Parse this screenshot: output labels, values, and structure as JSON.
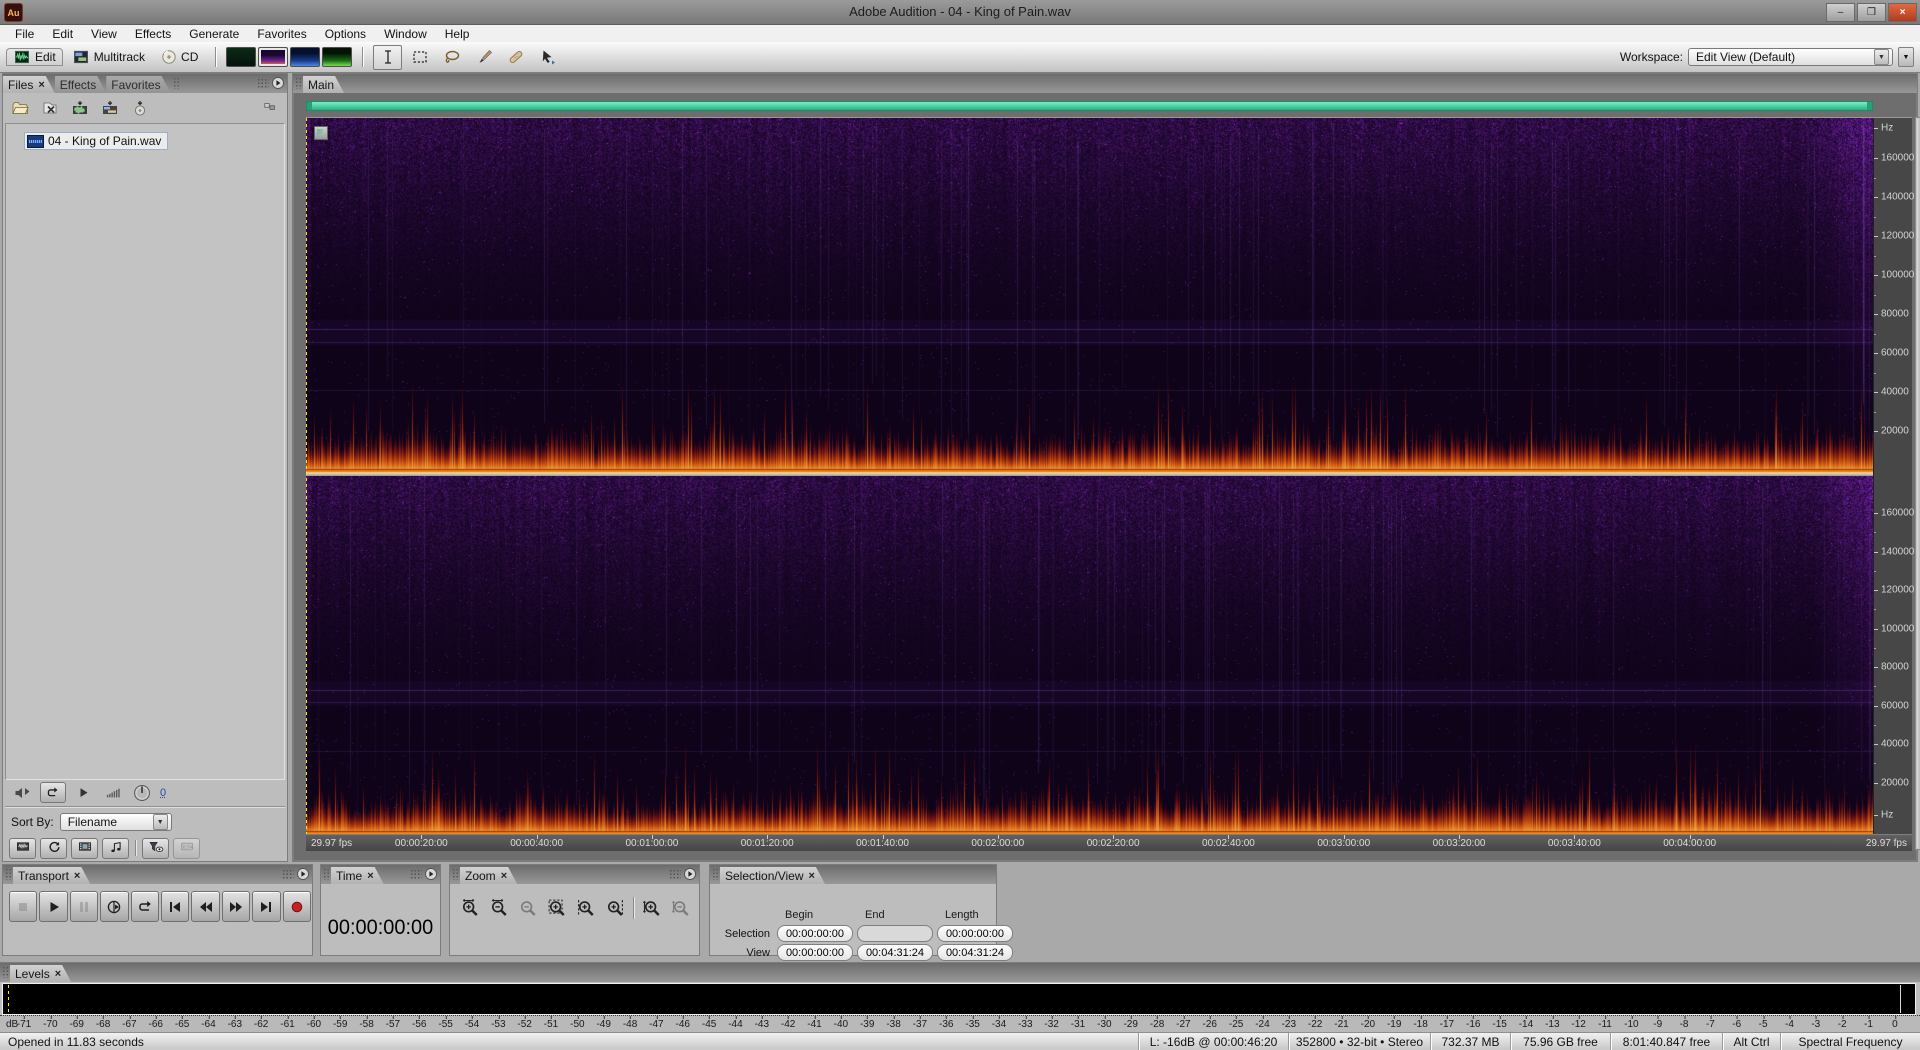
{
  "window": {
    "app_icon_label": "Au",
    "title": "Adobe Audition - 04 - King of Pain.wav"
  },
  "ui_glyphs": {
    "close": "×",
    "dropdown": "▼",
    "minimize": "–",
    "maximize": "❒"
  },
  "menu_bar": [
    "File",
    "Edit",
    "View",
    "Effects",
    "Generate",
    "Favorites",
    "Options",
    "Window",
    "Help"
  ],
  "toolbar": {
    "mode_buttons": [
      {
        "label": "Edit",
        "icon": "edit-view",
        "active": true
      },
      {
        "label": "Multitrack",
        "icon": "multitrack-view",
        "active": false
      },
      {
        "label": "CD",
        "icon": "cd-view",
        "active": false
      }
    ],
    "display_buttons": [
      {
        "name": "waveform-display",
        "active": false
      },
      {
        "name": "spectral-frequency-display",
        "active": true
      },
      {
        "name": "spectral-pan-display",
        "active": false
      },
      {
        "name": "spectral-phase-display",
        "active": false
      }
    ],
    "tool_buttons": [
      {
        "name": "time-selection-tool",
        "active": true
      },
      {
        "name": "marquee-selection-tool",
        "active": false
      },
      {
        "name": "lasso-selection-tool",
        "active": false
      },
      {
        "name": "effects-paintbrush-tool",
        "active": false
      },
      {
        "name": "spot-healing-brush-tool",
        "active": false
      },
      {
        "name": "scrub-tool",
        "active": false
      }
    ],
    "workspace_label": "Workspace:",
    "workspace_value": "Edit View (Default)"
  },
  "files_panel": {
    "tabs": [
      {
        "label": "Files",
        "active": true,
        "closable": true
      },
      {
        "label": "Effects",
        "active": false,
        "closable": false
      },
      {
        "label": "Favorites",
        "active": false,
        "closable": false
      }
    ],
    "toolbar_icons": [
      "import-file",
      "close-files",
      "edit-file",
      "insert-into-multitrack",
      "insert-into-cd"
    ],
    "advanced_options_icon": "advanced-options",
    "files": [
      {
        "name": "04 - King of Pain.wav",
        "selected": true
      }
    ],
    "preview_controls": [
      "auto-play",
      "loop-playback",
      "play-preview",
      "preview-volume",
      "preview-knob"
    ],
    "preview_value": "0",
    "sort_by_label": "Sort By:",
    "sort_by_value": "Filename",
    "filter_buttons": [
      "show-audio-files",
      "show-loop-files",
      "show-video-files",
      "show-midi-files",
      "filter-options",
      "show-full-paths"
    ]
  },
  "main_panel": {
    "tab_label": "Main",
    "time_ruler": {
      "left_label": "29.97 fps",
      "right_label": "29.97 fps",
      "labels": [
        "00:00:20:00",
        "00:00:40:00",
        "00:01:00:00",
        "00:01:20:00",
        "00:01:40:00",
        "00:02:00:00",
        "00:02:20:00",
        "00:02:40:00",
        "00:03:00:00",
        "00:03:20:00",
        "00:03:40:00",
        "00:04:00:00"
      ],
      "label_interval_seconds": 20,
      "view_length_seconds": 271.8
    },
    "frequency_scale": {
      "unit": "Hz",
      "top_channel_labels": [
        "160000",
        "140000",
        "120000",
        "100000",
        "80000",
        "60000",
        "40000",
        "20000"
      ],
      "bottom_channel_labels": [
        "160000",
        "140000",
        "120000",
        "100000",
        "80000",
        "60000",
        "40000",
        "20000"
      ]
    }
  },
  "spectral_view": {
    "scrollbar_color": "#45dfb2",
    "playhead_color": "#ffe400",
    "background_color": "#05020b",
    "haze_color": "#6a30b8",
    "flame_colors": [
      "#6e0a14",
      "#c42806",
      "#f07010",
      "#ffd24a"
    ]
  },
  "transport_panel": {
    "tab_label": "Transport",
    "buttons": [
      {
        "name": "stop",
        "disabled": true
      },
      {
        "name": "play",
        "disabled": false
      },
      {
        "name": "pause",
        "disabled": true
      },
      {
        "name": "play-from-cursor",
        "disabled": false
      },
      {
        "name": "play-looped",
        "disabled": false
      },
      {
        "name": "go-to-beginning",
        "disabled": false
      },
      {
        "name": "rewind",
        "disabled": false
      },
      {
        "name": "fast-forward",
        "disabled": false
      },
      {
        "name": "go-to-end",
        "disabled": false
      },
      {
        "name": "record",
        "disabled": false
      }
    ]
  },
  "time_panel": {
    "tab_label": "Time",
    "value": "00:00:00:00"
  },
  "zoom_panel": {
    "tab_label": "Zoom",
    "buttons": [
      {
        "name": "zoom-in-horizontally",
        "disabled": false
      },
      {
        "name": "zoom-out-horizontally",
        "disabled": false
      },
      {
        "name": "zoom-out-full",
        "disabled": true
      },
      {
        "name": "zoom-to-selection",
        "disabled": false
      },
      {
        "name": "zoom-in-to-selection-left-edge",
        "disabled": false
      },
      {
        "name": "zoom-in-to-selection-right-edge",
        "disabled": false
      },
      {
        "name": "zoom-in-vertically",
        "disabled": false
      },
      {
        "name": "zoom-out-vertically",
        "disabled": true
      }
    ]
  },
  "selection_view_panel": {
    "tab_label": "Selection/View",
    "column_headers": [
      "Begin",
      "End",
      "Length"
    ],
    "rows": [
      {
        "label": "Selection",
        "values": [
          "00:00:00:00",
          "",
          "00:00:00:00"
        ]
      },
      {
        "label": "View",
        "values": [
          "00:00:00:00",
          "00:04:31:24",
          "00:04:31:24"
        ]
      }
    ]
  },
  "levels_panel": {
    "tab_label": "Levels",
    "unit_label": "dB",
    "scale_labels": [
      "-71",
      "-70",
      "-69",
      "-68",
      "-67",
      "-66",
      "-65",
      "-64",
      "-63",
      "-62",
      "-61",
      "-60",
      "-59",
      "-58",
      "-57",
      "-56",
      "-55",
      "-54",
      "-53",
      "-52",
      "-51",
      "-50",
      "-49",
      "-48",
      "-47",
      "-46",
      "-45",
      "-44",
      "-43",
      "-42",
      "-41",
      "-40",
      "-39",
      "-38",
      "-37",
      "-36",
      "-35",
      "-34",
      "-33",
      "-32",
      "-31",
      "-30",
      "-29",
      "-28",
      "-27",
      "-26",
      "-25",
      "-24",
      "-23",
      "-22",
      "-21",
      "-20",
      "-19",
      "-18",
      "-17",
      "-16",
      "-15",
      "-14",
      "-13",
      "-12",
      "-11",
      "-10",
      "-9",
      "-8",
      "-7",
      "-6",
      "-5",
      "-4",
      "-3",
      "-2",
      "-1",
      "0"
    ]
  },
  "status_bar": {
    "left_text": "Opened in 11.83 seconds",
    "segments": [
      "L: -16dB @ 00:00:46:20",
      "352800 • 32-bit • Stereo",
      "732.37 MB",
      "75.96 GB free",
      "8:01:40.847 free",
      "Alt Ctrl",
      "Spectral Frequency"
    ]
  }
}
